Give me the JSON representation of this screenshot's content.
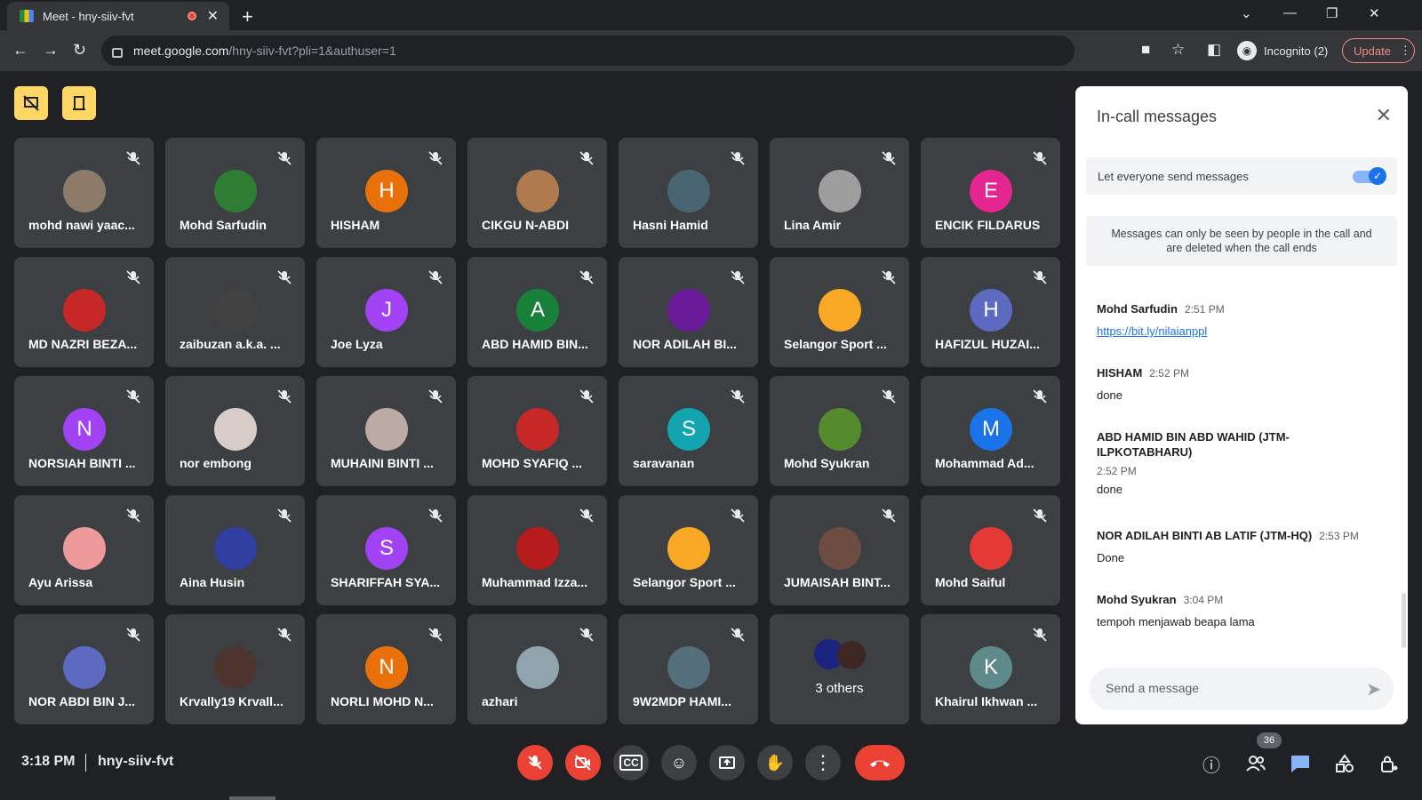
{
  "browser": {
    "tab_title": "Meet - hny-siiv-fvt",
    "url_host": "meet.google.com",
    "url_path": "/hny-siiv-fvt?pli=1&authuser=1",
    "incognito_label": "Incognito (2)",
    "update_label": "Update"
  },
  "participants": [
    {
      "name": "mohd nawi yaac...",
      "initial": "",
      "color": "#8d7b6a"
    },
    {
      "name": "Mohd Sarfudin",
      "initial": "",
      "color": "#2e7d32"
    },
    {
      "name": "HISHAM",
      "initial": "H",
      "color": "#e8710a"
    },
    {
      "name": "CIKGU N-ABDI",
      "initial": "",
      "color": "#b07a4f"
    },
    {
      "name": "Hasni Hamid",
      "initial": "",
      "color": "#4a6572"
    },
    {
      "name": "Lina Amir",
      "initial": "",
      "color": "#9e9e9e"
    },
    {
      "name": "ENCIK FILDARUS",
      "initial": "E",
      "color": "#e52592"
    },
    {
      "name": "MD NAZRI BEZA...",
      "initial": "",
      "color": "#c62828"
    },
    {
      "name": "zaibuzan a.k.a. ...",
      "initial": "",
      "color": "#424242"
    },
    {
      "name": "Joe Lyza",
      "initial": "J",
      "color": "#a142f4"
    },
    {
      "name": "ABD HAMID BIN...",
      "initial": "A",
      "color": "#188038"
    },
    {
      "name": "NOR ADILAH BI...",
      "initial": "",
      "color": "#6a1b9a"
    },
    {
      "name": "Selangor Sport ...",
      "initial": "",
      "color": "#f9a825"
    },
    {
      "name": "HAFIZUL HUZAI...",
      "initial": "H",
      "color": "#5c6bc0"
    },
    {
      "name": "NORSIAH BINTI ...",
      "initial": "N",
      "color": "#a142f4"
    },
    {
      "name": "nor embong",
      "initial": "",
      "color": "#d7ccc8"
    },
    {
      "name": "MUHAINI BINTI ...",
      "initial": "",
      "color": "#bcaaa4"
    },
    {
      "name": "MOHD SYAFIQ ...",
      "initial": "",
      "color": "#c62828"
    },
    {
      "name": "saravanan",
      "initial": "S",
      "color": "#12a4af"
    },
    {
      "name": "Mohd Syukran",
      "initial": "",
      "color": "#558b2f"
    },
    {
      "name": "Mohammad Ad...",
      "initial": "M",
      "color": "#1a73e8"
    },
    {
      "name": "Ayu Arissa",
      "initial": "",
      "color": "#ef9a9a"
    },
    {
      "name": "Aina Husin",
      "initial": "",
      "color": "#303f9f"
    },
    {
      "name": "SHARIFFAH SYA...",
      "initial": "S",
      "color": "#a142f4"
    },
    {
      "name": "Muhammad Izza...",
      "initial": "",
      "color": "#b71c1c"
    },
    {
      "name": "Selangor Sport ...",
      "initial": "",
      "color": "#f9a825"
    },
    {
      "name": "JUMAISAH BINT...",
      "initial": "",
      "color": "#6d4c41"
    },
    {
      "name": "Mohd Saiful",
      "initial": "",
      "color": "#e53935"
    },
    {
      "name": "NOR ABDI BIN J...",
      "initial": "",
      "color": "#5c6bc0"
    },
    {
      "name": "Krvally19 Krvall...",
      "initial": "",
      "color": "#4e342e"
    },
    {
      "name": "NORLI MOHD N...",
      "initial": "N",
      "color": "#e8710a"
    },
    {
      "name": "azhari",
      "initial": "",
      "color": "#90a4ae"
    },
    {
      "name": "9W2MDP HAMI...",
      "initial": "",
      "color": "#546e7a"
    },
    {
      "name": "3 others",
      "initial": "",
      "color": "#3949ab",
      "others": true
    },
    {
      "name": "Khairul Ikhwan ...",
      "initial": "K",
      "color": "#5f8a8b"
    }
  ],
  "chat": {
    "title": "In-call messages",
    "setting_label": "Let everyone send messages",
    "notice": "Messages can only be seen by people in the call and are deleted when the call ends",
    "messages": [
      {
        "sender": "Mohd Sarfudin",
        "time": "2:51 PM",
        "body": "https://bit.ly/nilaianppl",
        "link": true
      },
      {
        "sender": "HISHAM",
        "time": "2:52 PM",
        "body": "done"
      },
      {
        "sender": "ABD HAMID BIN ABD WAHID (JTM-ILPKOTABHARU)",
        "time": "2:52 PM",
        "body": "done"
      },
      {
        "sender": "NOR ADILAH BINTI AB LATIF (JTM-HQ)",
        "time": "2:53 PM",
        "body": "Done"
      },
      {
        "sender": "Mohd Syukran",
        "time": "3:04 PM",
        "body": "tempoh menjawab beapa lama"
      }
    ],
    "compose_placeholder": "Send a message"
  },
  "footer": {
    "time": "3:18 PM",
    "meeting_code": "hny-siiv-fvt",
    "participant_count": "36"
  }
}
